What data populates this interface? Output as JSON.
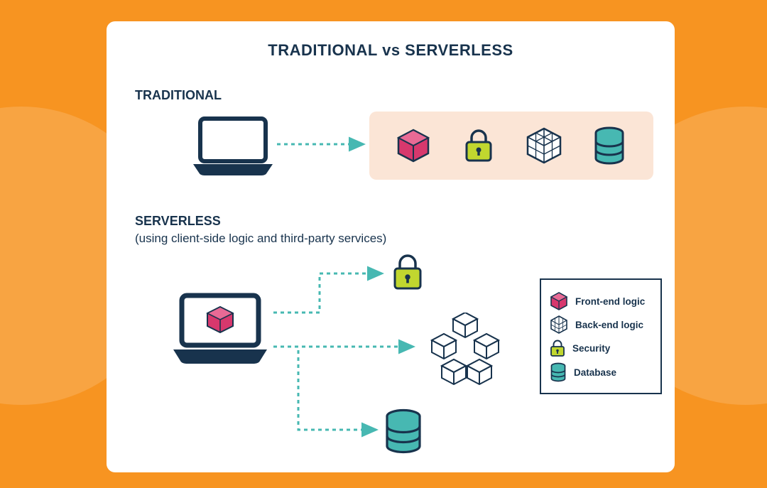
{
  "title": "TRADITIONAL vs SERVERLESS",
  "traditional": {
    "label": "TRADITIONAL"
  },
  "serverless": {
    "label": "SERVERLESS",
    "subtitle": "(using client-side logic and third-party services)"
  },
  "legend": {
    "frontend": "Front-end logic",
    "backend": "Back-end logic",
    "security": "Security",
    "database": "Database"
  },
  "colors": {
    "navy": "#18334d",
    "pink": "#d7386d",
    "lime": "#c1d72f",
    "teal": "#47b8b2",
    "beige": "#fbe5d6",
    "orange": "#F79421"
  }
}
